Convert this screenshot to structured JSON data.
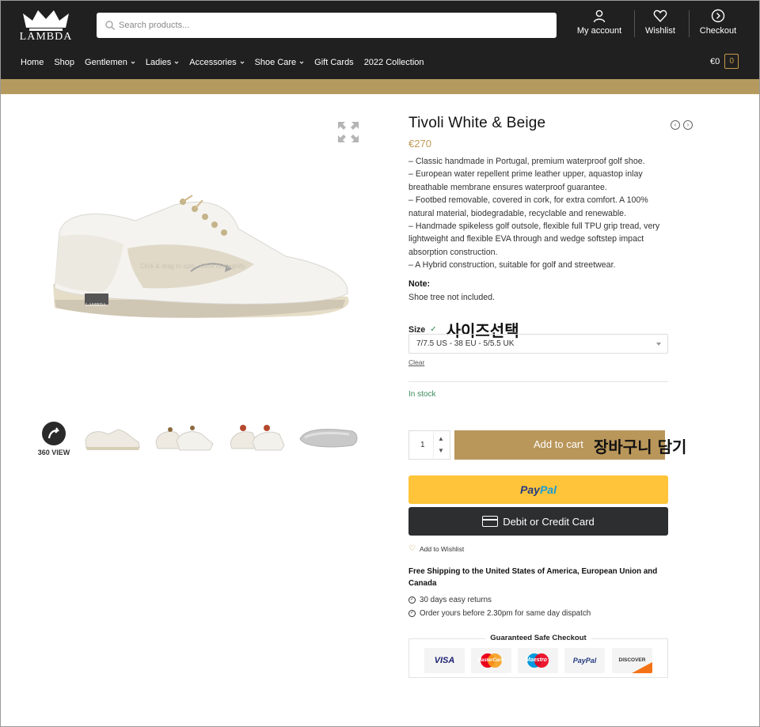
{
  "header": {
    "logo_text": "LAMBDA",
    "search_placeholder": "Search products...",
    "account_label": "My account",
    "wishlist_label": "Wishlist",
    "checkout_label": "Checkout",
    "cart_total": "€0",
    "cart_count": "0"
  },
  "nav": {
    "items": [
      {
        "label": "Home",
        "dropdown": false
      },
      {
        "label": "Shop",
        "dropdown": false
      },
      {
        "label": "Gentlemen",
        "dropdown": true
      },
      {
        "label": "Ladies",
        "dropdown": true
      },
      {
        "label": "Accessories",
        "dropdown": true
      },
      {
        "label": "Shoe Care",
        "dropdown": true
      },
      {
        "label": "Gift Cards",
        "dropdown": false
      },
      {
        "label": "2022 Collection",
        "dropdown": false
      }
    ]
  },
  "gallery": {
    "drag_hint": "Click & drag to spin · Click to magnify",
    "shoe_logo": "LAMBDA",
    "view360_label": "360 VIEW"
  },
  "product": {
    "title": "Tivoli White & Beige",
    "price": "€270",
    "description": [
      "– Classic handmade in Portugal, premium waterproof golf shoe.",
      "– European water repellent prime leather upper, aquastop inlay breathable membrane ensures waterproof guarantee.",
      "– Footbed removable, covered in cork, for extra comfort. A 100% natural material, biodegradable, recyclable and renewable.",
      "– Handmade spikeless golf outsole, flexible full TPU grip tread, very lightweight and flexible EVA through and wedge softstep impact absorption construction.",
      "– A Hybrid construction, suitable for golf and streetwear."
    ],
    "note_heading": "Note:",
    "note_text": "Shoe tree not included.",
    "size_label": "Size",
    "size_annotation": "사이즈선택",
    "size_value": "7/7.5 US - 38 EU - 5/5.5 UK",
    "clear_label": "Clear",
    "stock_status": "In stock",
    "quantity": "1",
    "add_to_cart_label": "Add to cart",
    "cart_annotation": "장바구니 담기",
    "paypal_p1": "Pay",
    "paypal_p2": "Pal",
    "card_button_label": "Debit or Credit Card",
    "wishlist_link": "Add to Wishlist",
    "shipping_text": "Free Shipping to the United States of America, European Union and Canada",
    "benefits": [
      "30 days easy returns",
      "Order yours before 2.30pm for same day dispatch"
    ],
    "secure_title": "Guaranteed Safe Checkout",
    "payment_methods": [
      "VISA",
      "MasterCard",
      "Maestro",
      "PayPal",
      "DISCOVER"
    ]
  },
  "colors": {
    "header_bg": "#202020",
    "gold": "#b59a5f",
    "price": "#c09a55",
    "paypal_yellow": "#ffc439",
    "card_dark": "#2c2e2f"
  }
}
